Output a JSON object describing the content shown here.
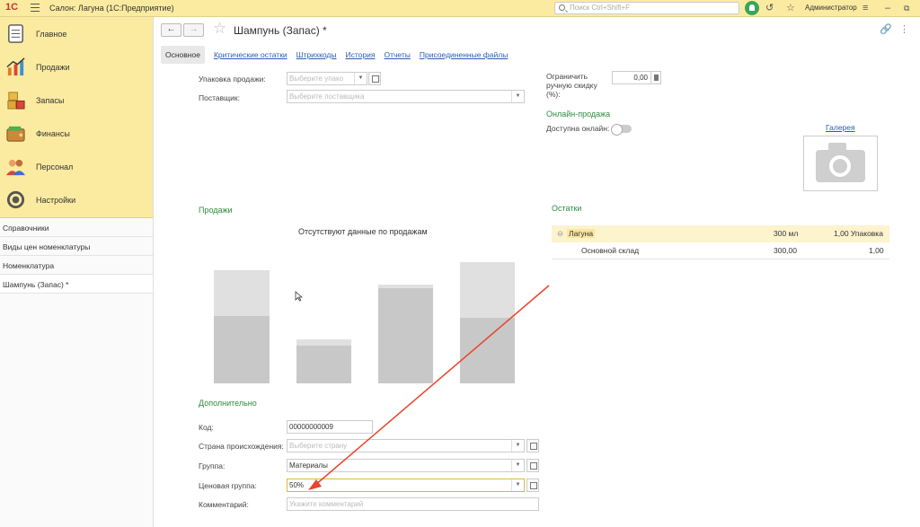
{
  "topbar": {
    "logo": "1С",
    "title": "Салон: Лагуна  (1С:Предприятие)",
    "search_placeholder": "Поиск Ctrl+Shift+F",
    "user": "Администратор"
  },
  "sidebar": {
    "nav": [
      {
        "label": "Главное",
        "icon": "list-icon"
      },
      {
        "label": "Продажи",
        "icon": "chart-icon"
      },
      {
        "label": "Запасы",
        "icon": "boxes-icon"
      },
      {
        "label": "Финансы",
        "icon": "wallet-icon"
      },
      {
        "label": "Персонал",
        "icon": "people-icon"
      },
      {
        "label": "Настройки",
        "icon": "gear-icon"
      }
    ],
    "open_windows": [
      "Справочники",
      "Виды цен номенклатуры",
      "Номенклатура",
      "Шампунь (Запас) *"
    ]
  },
  "form": {
    "title": "Шампунь (Запас) *",
    "tabs": [
      "Основное",
      "Критические остатки",
      "Штрихкоды",
      "История",
      "Отчеты",
      "Присоединенные файлы"
    ],
    "package_label": "Упаковка продажи:",
    "package_placeholder": "Выберите упако",
    "supplier_label": "Поставщик:",
    "supplier_placeholder": "Выберите поставщика",
    "discount_label_1": "Ограничить",
    "discount_label_2": "ручную скидку",
    "discount_label_3": "(%):",
    "discount_value": "0,00",
    "online_title": "Онлайн-продажа",
    "online_label": "Доступна онлайн:",
    "gallery_link": "Галерея",
    "sales_title": "Продажи",
    "sales_empty": "Отсутствуют данные по продажам",
    "stock_title": "Остатки",
    "stock_rows": [
      {
        "name": "Лагуна",
        "qty": "300 мл",
        "pack": "1,00 Упаковка"
      },
      {
        "name": "Основной склад",
        "qty": "300,00",
        "pack": "1,00"
      }
    ],
    "extra_title": "Дополнительно",
    "code_label": "Код:",
    "code_value": "00000000009",
    "country_label": "Страна происхождения:",
    "country_placeholder": "Выберите страну",
    "group_label": "Группа:",
    "group_value": "Материалы",
    "price_group_label": "Ценовая группа:",
    "price_group_value": "50%",
    "comment_label": "Комментарий:",
    "comment_placeholder": "Укажите комментарий"
  },
  "colors": {
    "panel": "#fbeba0",
    "link": "#2a5db0",
    "section": "#2e8b3e",
    "annotation_arrow": "#e8442b"
  }
}
